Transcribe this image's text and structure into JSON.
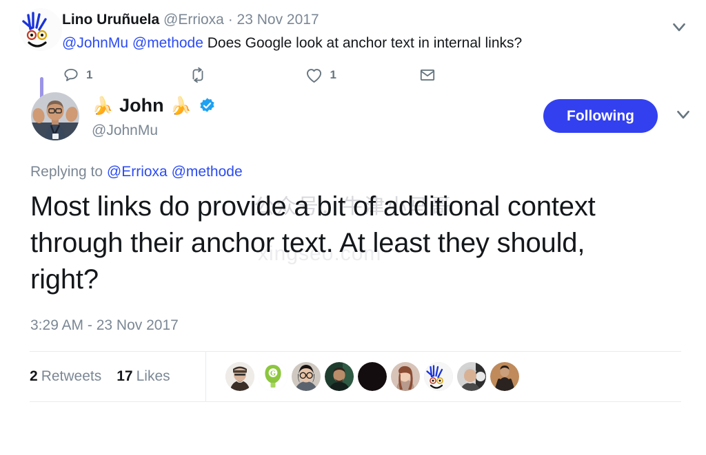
{
  "colors": {
    "link": "#2b4bf2",
    "follow_button_bg": "#3340f0",
    "muted_text": "#7b8794",
    "thread_line": "#9b94e8",
    "verified_badge": "#1da1f2",
    "separator": "#e6ecf0"
  },
  "watermark": {
    "line1": "公众号：牛津小马哥",
    "line2": "xingseo.com"
  },
  "ancestor_tweet": {
    "avatar_name": "errioxa-avatar",
    "display_name": "Lino Uruñuela",
    "handle": "@Errioxa",
    "separator": "·",
    "date": "23 Nov 2017",
    "text_mention_1": "@JohnMu",
    "text_mention_2": "@methode",
    "text_body": " Does Google look at anchor text in internal links?",
    "actions": [
      {
        "name": "reply",
        "icon": "reply-icon",
        "count": "1"
      },
      {
        "name": "retweet",
        "icon": "retweet-icon",
        "count": ""
      },
      {
        "name": "like",
        "icon": "heart-icon",
        "count": "1"
      },
      {
        "name": "direct-message",
        "icon": "envelope-icon",
        "count": ""
      }
    ],
    "caret_icon": "chevron-down-icon"
  },
  "main_tweet": {
    "avatar_name": "johnmu-avatar",
    "emoji_left": "🍌",
    "display_name": "John",
    "emoji_right": "🍌",
    "verified_icon": "verified-badge-icon",
    "handle": "@JohnMu",
    "follow_label": "Following",
    "caret_icon": "chevron-down-icon",
    "replying_prefix": "Replying to ",
    "replying_mention_1": "@Errioxa",
    "replying_mention_2": "@methode",
    "text": "Most links do provide a bit of additional context through their anchor text. At least they should, right?",
    "timestamp": "3:29 AM - 23 Nov 2017",
    "stats": {
      "retweets_count": "2",
      "retweets_label": "Retweets",
      "likes_count": "17",
      "likes_label": "Likes"
    },
    "facepile": [
      {
        "name": "liker-avatar-1",
        "bg": "#efece8",
        "fg": "#4a3f38"
      },
      {
        "name": "liker-avatar-2",
        "bg": "#ffffff",
        "fg": "#8cc63f"
      },
      {
        "name": "liker-avatar-3",
        "bg": "#d9d2cb",
        "fg": "#241f1c"
      },
      {
        "name": "liker-avatar-4",
        "bg": "#1e3d2f",
        "fg": "#b98c6a"
      },
      {
        "name": "liker-avatar-5",
        "bg": "#140d0f",
        "fg": "#140d0f"
      },
      {
        "name": "liker-avatar-6",
        "bg": "#d7c3b8",
        "fg": "#8a4c33"
      },
      {
        "name": "liker-avatar-7",
        "bg": "#f4f4f4",
        "fg": "#2233cc"
      },
      {
        "name": "liker-avatar-8",
        "bg": "#cfcfcf",
        "fg": "#3a3a3a"
      },
      {
        "name": "liker-avatar-9",
        "bg": "#c08a5a",
        "fg": "#2a2320"
      }
    ]
  }
}
